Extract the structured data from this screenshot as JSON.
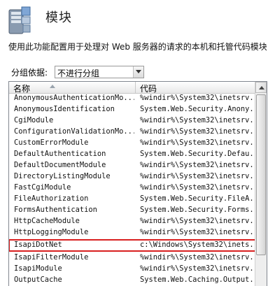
{
  "header": {
    "title": "模块",
    "icon": "server-modules-icon"
  },
  "description": "使用此功能配置用于处理对 Web 服务器的请求的本机和托管代码模块",
  "group": {
    "label": "分组依据:",
    "selected": "不进行分组"
  },
  "table": {
    "columns": [
      "名称",
      "代码"
    ],
    "rows": [
      {
        "name": "AnonymousAuthenticationMo...",
        "code": "%windir%\\System32\\inetsrv..."
      },
      {
        "name": "AnonymousIdentification",
        "code": "System.Web.Security.Anony..."
      },
      {
        "name": "CgiModule",
        "code": "%windir%\\System32\\inetsrv..."
      },
      {
        "name": "ConfigurationValidationMo...",
        "code": "%windir%\\System32\\inetsrv..."
      },
      {
        "name": "CustomErrorModule",
        "code": "%windir%\\System32\\inetsrv..."
      },
      {
        "name": "DefaultAuthentication",
        "code": "System.Web.Security.Defau..."
      },
      {
        "name": "DefaultDocumentModule",
        "code": "%windir%\\System32\\inetsrv..."
      },
      {
        "name": "DirectoryListingModule",
        "code": "%windir%\\System32\\inetsrv..."
      },
      {
        "name": "FastCgiModule",
        "code": "%windir%\\System32\\inetsrv..."
      },
      {
        "name": "FileAuthorization",
        "code": "System.Web.Security.FileA..."
      },
      {
        "name": "FormsAuthentication",
        "code": "System.Web.Security.Forms..."
      },
      {
        "name": "HttpCacheModule",
        "code": "%windir%\\System32\\inetsrv..."
      },
      {
        "name": "HttpLoggingModule",
        "code": "%windir%\\System32\\inetsrv..."
      },
      {
        "name": "IsapiDotNet",
        "code": "c:\\Windows\\System32\\inets..."
      },
      {
        "name": "IsapiFilterModule",
        "code": "%windir%\\System32\\inetsrv..."
      },
      {
        "name": "IsapiModule",
        "code": "%windir%\\System32\\inetsrv..."
      },
      {
        "name": "OutputCache",
        "code": "System.Web.Caching.Output..."
      }
    ],
    "selected_index": 13,
    "highlight_color": "#d92020"
  }
}
